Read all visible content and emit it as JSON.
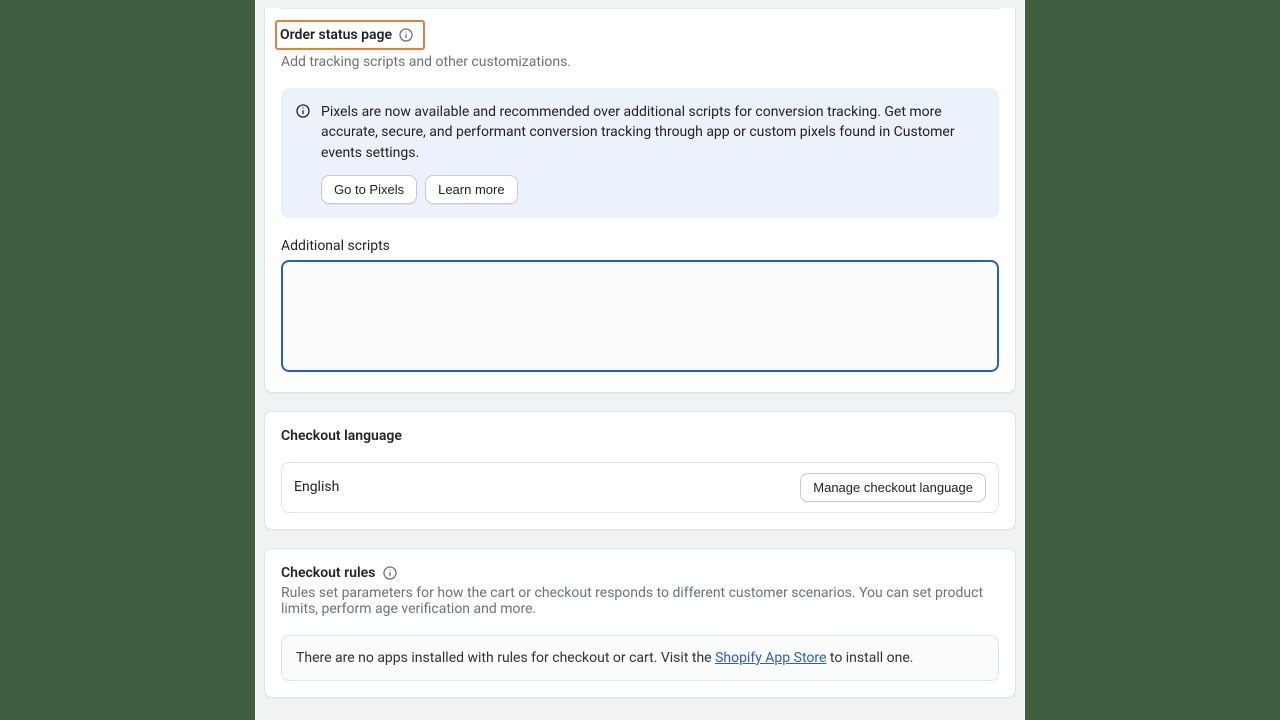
{
  "orderStatus": {
    "title": "Order status page",
    "subtitle": "Add tracking scripts and other customizations.",
    "banner": {
      "text": "Pixels are now available and recommended over additional scripts for conversion tracking. Get more accurate, secure, and performant conversion tracking through app or custom pixels found in Customer events settings.",
      "primary": "Go to Pixels",
      "secondary": "Learn more"
    },
    "scriptsLabel": "Additional scripts",
    "scriptsValue": ""
  },
  "checkoutLanguage": {
    "title": "Checkout language",
    "current": "English",
    "manage": "Manage checkout language"
  },
  "checkoutRules": {
    "title": "Checkout rules",
    "subtitle": "Rules set parameters for how the cart or checkout responds to different customer scenarios. You can set product limits, perform age verification and more.",
    "emptyPrefix": "There are no apps installed with rules for checkout or cart. Visit the ",
    "emptyLink": "Shopify App Store",
    "emptySuffix": " to install one."
  }
}
